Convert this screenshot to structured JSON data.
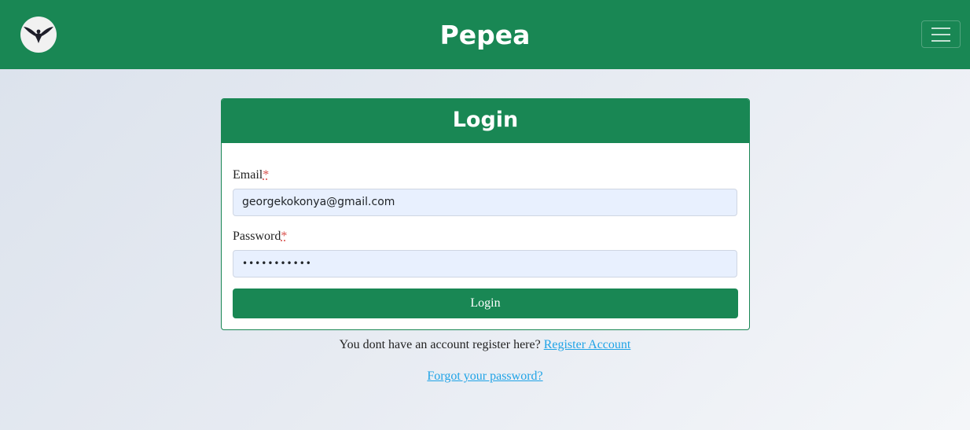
{
  "navbar": {
    "brand": "Pepea",
    "logo_icon": "bird-icon",
    "menu_icon": "hamburger-menu-icon",
    "color": "#198754"
  },
  "login_card": {
    "title": "Login",
    "email": {
      "label": "Email",
      "required_mark": "*",
      "value": "georgekokonya@gmail.com"
    },
    "password": {
      "label": "Password",
      "required_mark": "*",
      "value": "•••••••••••"
    },
    "submit_label": "Login"
  },
  "footer_links": {
    "register_prompt": "You dont have an account register here?",
    "register_link": "Register Account",
    "forgot_link": "Forgot your password?"
  },
  "colors": {
    "accent": "#198754",
    "link": "#1fa3e6",
    "input_bg": "#e8f0fe",
    "required": "#d9534f"
  }
}
